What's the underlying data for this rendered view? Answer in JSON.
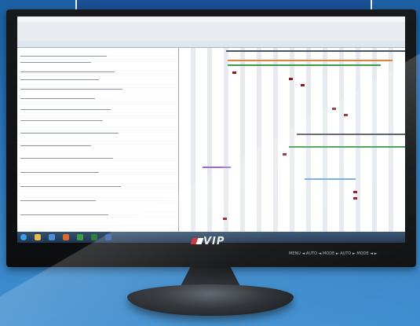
{
  "logo": {
    "text": "VIP"
  },
  "osd": {
    "text": "MENU ◄  AUTO ◄  MODE ►  AUTO ►  MODE ◄ ►"
  },
  "colors": {
    "background": "#2b77bd",
    "header_bar": "#1a4f93",
    "summary_bar": "#4a5560",
    "task_bar": "#8b1a22",
    "blue_bar": "#6ea8e8",
    "green_bar": "#3c9a4a",
    "orange_bar": "#e0813a",
    "purple_bar": "#9b6bc5"
  },
  "icons": [
    "windows-start-icon",
    "folder-icon",
    "browser-icon",
    "media-icon",
    "project-icon",
    "excel-icon",
    "word-icon"
  ]
}
